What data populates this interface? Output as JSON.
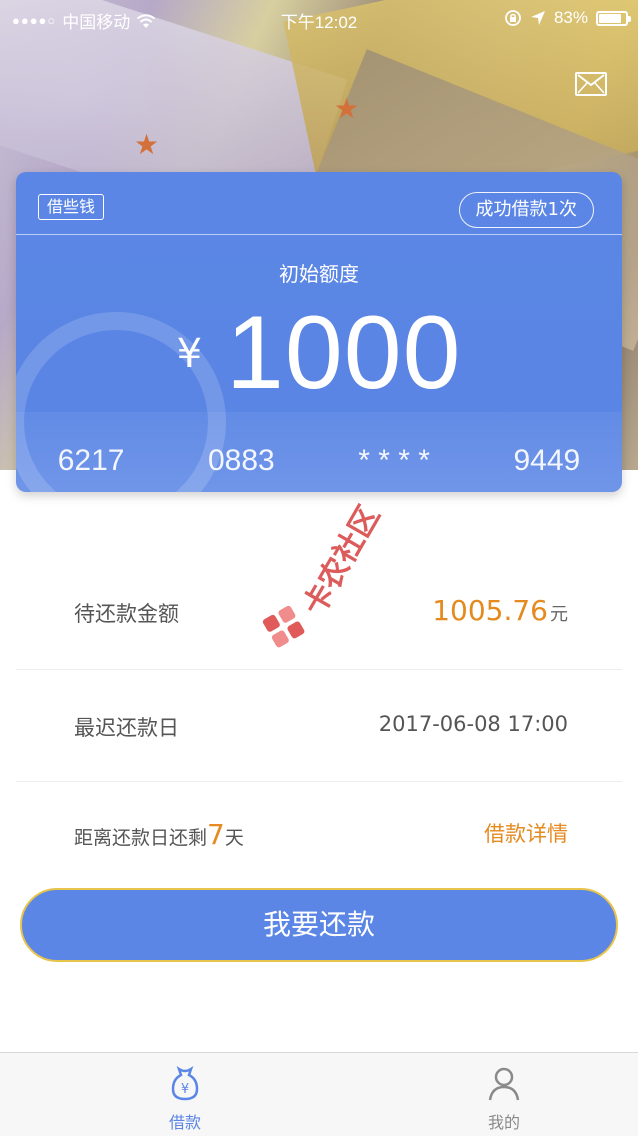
{
  "status_bar": {
    "signal_dots": "●●●●○",
    "carrier": "中国移动",
    "time": "下午12:02",
    "battery": "83%",
    "battery_level": 0.83
  },
  "header": {
    "icons": [
      "wifi-icon",
      "rotation-lock-icon",
      "location-icon",
      "battery-icon",
      "mail-icon"
    ]
  },
  "card": {
    "tag": "借些钱",
    "success_badge": "成功借款1次",
    "label": "初始额度",
    "currency": "¥",
    "amount": "1000",
    "card_number": [
      "6217",
      "0883",
      "* * * *",
      "9449"
    ]
  },
  "details": {
    "pending_label": "待还款金额",
    "pending_amount": "1005.76",
    "pending_unit": "元",
    "deadline_label": "最迟还款日",
    "deadline_value": "2017-06-08 17:00",
    "remaining_prefix": "距离还款日还剩",
    "remaining_days": "7",
    "remaining_suffix": "天",
    "detail_link": "借款详情"
  },
  "repay_button": "我要还款",
  "watermark": "卡农社区",
  "tabbar": {
    "tabs": [
      {
        "label": "借款",
        "icon": "money-bag-icon",
        "active": true
      },
      {
        "label": "我的",
        "icon": "user-icon",
        "active": false
      }
    ]
  },
  "colors": {
    "primary": "#5b86e5",
    "accent": "#e58a1f",
    "button_border": "#e7c44b"
  }
}
